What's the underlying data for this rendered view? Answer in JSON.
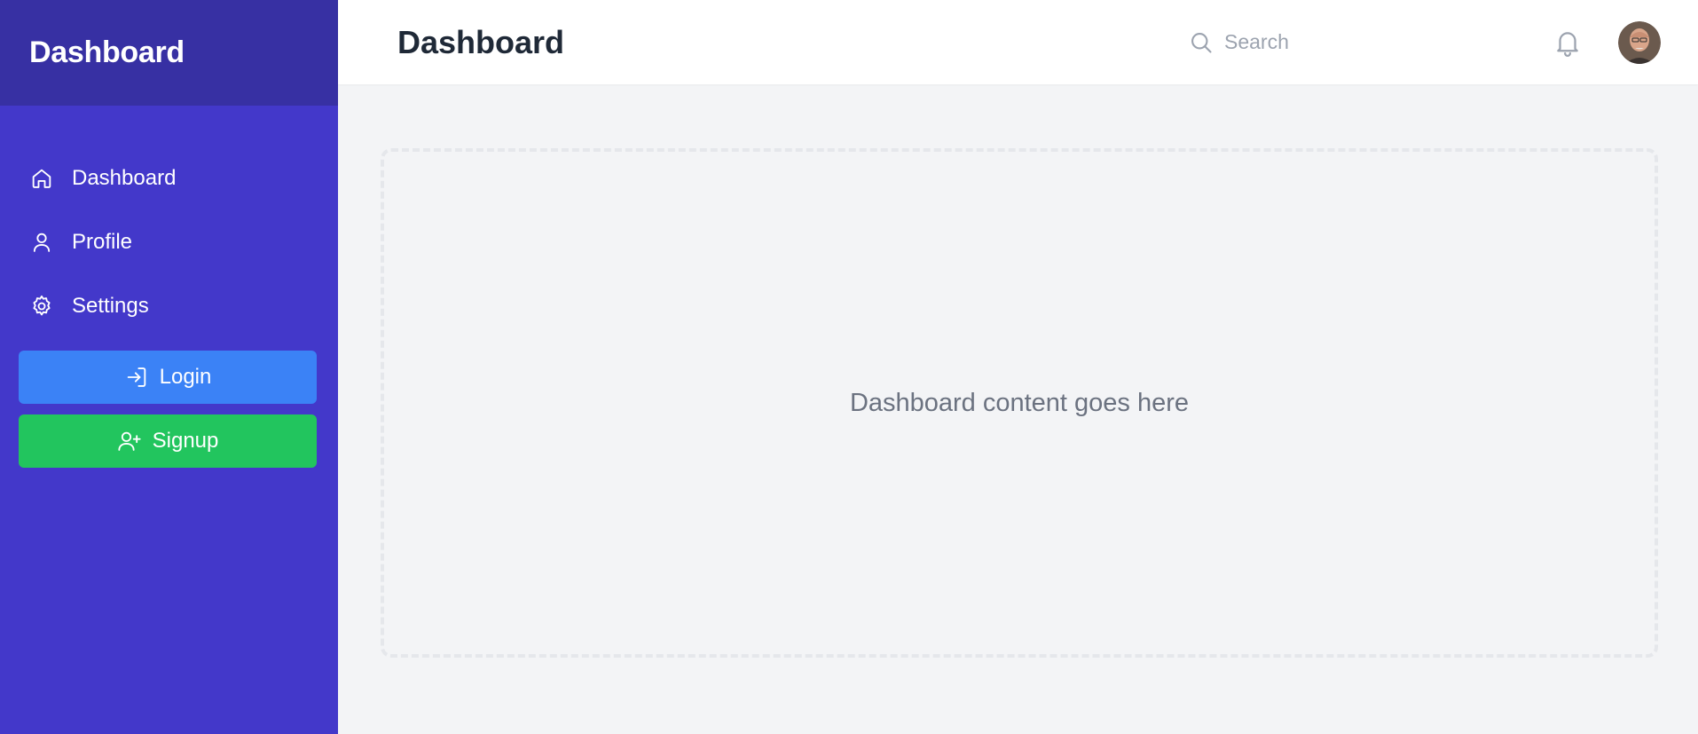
{
  "sidebar": {
    "brand": "Dashboard",
    "items": [
      {
        "label": "Dashboard",
        "icon": "home-icon"
      },
      {
        "label": "Profile",
        "icon": "user-icon"
      },
      {
        "label": "Settings",
        "icon": "gear-icon"
      }
    ],
    "login_label": "Login",
    "signup_label": "Signup"
  },
  "header": {
    "title": "Dashboard",
    "search_placeholder": "Search"
  },
  "main": {
    "placeholder_text": "Dashboard content goes here"
  },
  "colors": {
    "sidebar_bg": "#4338ca",
    "sidebar_header_bg": "#3730a3",
    "login_button": "#3b82f6",
    "signup_button": "#22c55e",
    "main_bg": "#f3f4f6"
  }
}
